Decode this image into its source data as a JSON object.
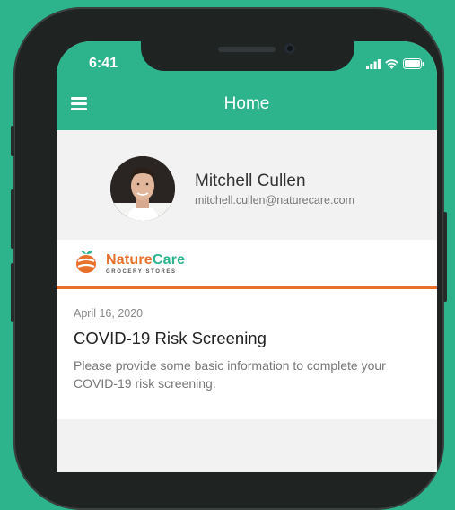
{
  "status_bar": {
    "time": "6:41"
  },
  "app_bar": {
    "title": "Home"
  },
  "profile": {
    "name": "Mitchell Cullen",
    "email": "mitchell.cullen@naturecare.com"
  },
  "brand": {
    "name_part1": "Nature",
    "name_part2": "Care",
    "tagline": "GROCERY STORES"
  },
  "card": {
    "date": "April 16, 2020",
    "title": "COVID-19 Risk Screening",
    "description": "Please provide some basic information to complete your COVID-19 risk screening."
  },
  "colors": {
    "accent": "#2db48d",
    "brand_orange": "#e8702a",
    "background": "#f2f2f2",
    "card": "#ffffff"
  },
  "icons": [
    "menu-icon",
    "cellular-signal-icon",
    "wifi-icon",
    "battery-icon",
    "naturecare-logo"
  ]
}
